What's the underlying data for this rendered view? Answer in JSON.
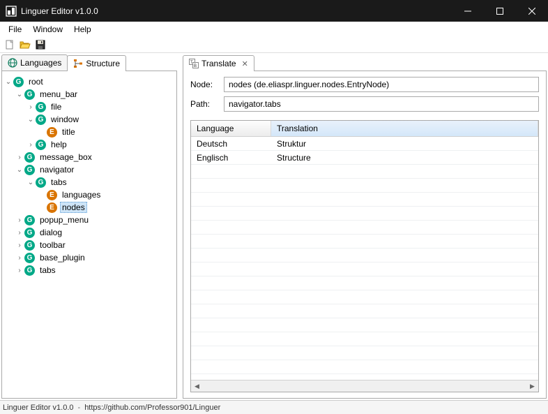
{
  "window": {
    "title": "Linguer Editor v1.0.0"
  },
  "menu": {
    "file": "File",
    "window": "Window",
    "help": "Help"
  },
  "left_tabs": {
    "languages": "Languages",
    "structure": "Structure"
  },
  "right_tabs": {
    "translate": "Translate"
  },
  "fields": {
    "node_label": "Node:",
    "node_value": "nodes  (de.eliaspr.linguer.nodes.EntryNode)",
    "path_label": "Path:",
    "path_value": "navigator.tabs"
  },
  "table": {
    "col_lang": "Language",
    "col_trans": "Translation",
    "rows": [
      {
        "lang": "Deutsch",
        "trans": "Struktur"
      },
      {
        "lang": "Englisch",
        "trans": "Structure"
      }
    ]
  },
  "tree": [
    {
      "depth": 0,
      "icon": "g",
      "label": "root",
      "twisty": "open"
    },
    {
      "depth": 1,
      "icon": "g",
      "label": "menu_bar",
      "twisty": "open"
    },
    {
      "depth": 2,
      "icon": "g",
      "label": "file",
      "twisty": "closed"
    },
    {
      "depth": 2,
      "icon": "g",
      "label": "window",
      "twisty": "open"
    },
    {
      "depth": 3,
      "icon": "e",
      "label": "title",
      "twisty": "none"
    },
    {
      "depth": 2,
      "icon": "g",
      "label": "help",
      "twisty": "closed"
    },
    {
      "depth": 1,
      "icon": "g",
      "label": "message_box",
      "twisty": "closed"
    },
    {
      "depth": 1,
      "icon": "g",
      "label": "navigator",
      "twisty": "open"
    },
    {
      "depth": 2,
      "icon": "g",
      "label": "tabs",
      "twisty": "open"
    },
    {
      "depth": 3,
      "icon": "e",
      "label": "languages",
      "twisty": "none"
    },
    {
      "depth": 3,
      "icon": "e",
      "label": "nodes",
      "twisty": "none",
      "selected": true
    },
    {
      "depth": 1,
      "icon": "g",
      "label": "popup_menu",
      "twisty": "closed"
    },
    {
      "depth": 1,
      "icon": "g",
      "label": "dialog",
      "twisty": "closed"
    },
    {
      "depth": 1,
      "icon": "g",
      "label": "toolbar",
      "twisty": "closed"
    },
    {
      "depth": 1,
      "icon": "g",
      "label": "base_plugin",
      "twisty": "closed"
    },
    {
      "depth": 1,
      "icon": "g",
      "label": "tabs",
      "twisty": "closed"
    }
  ],
  "status": {
    "app": "Linguer Editor v1.0.0",
    "url": "https://github.com/Professor901/Linguer"
  }
}
